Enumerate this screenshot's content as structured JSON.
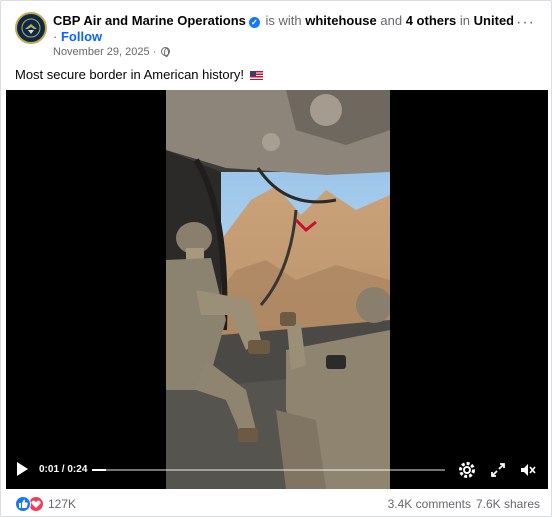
{
  "post": {
    "page_name": "CBP Air and Marine Operations",
    "verified_icon": "verified-badge-icon",
    "with_text": "is with",
    "tagged_primary": "whitehouse",
    "and_text": "and",
    "tagged_others": "4 others",
    "in_text": "in",
    "location": "United States...",
    "follow_prefix": "·",
    "follow_label": "Follow",
    "date": "November 29, 2025",
    "date_separator": "·",
    "audience_icon": "globe-icon",
    "more_icon": "more-options-icon",
    "more_glyph": "···",
    "caption": "Most secure border in American history!",
    "caption_emoji": "us-flag-icon"
  },
  "video": {
    "current_time": "0:01",
    "time_separator": " / ",
    "duration": "0:24",
    "progress_fraction": 0.04,
    "icons": [
      "play-icon",
      "settings-icon",
      "fullscreen-icon",
      "volume-muted-icon"
    ]
  },
  "stats": {
    "reactions": "127K",
    "reaction_icons": [
      "like-icon",
      "love-icon"
    ],
    "comments": "3.4K comments",
    "shares": "7.6K shares"
  },
  "colors": {
    "link_blue": "#0866ff",
    "verified_blue": "#1877f2",
    "love_red": "#f33e58",
    "muted_text": "#65676b"
  }
}
